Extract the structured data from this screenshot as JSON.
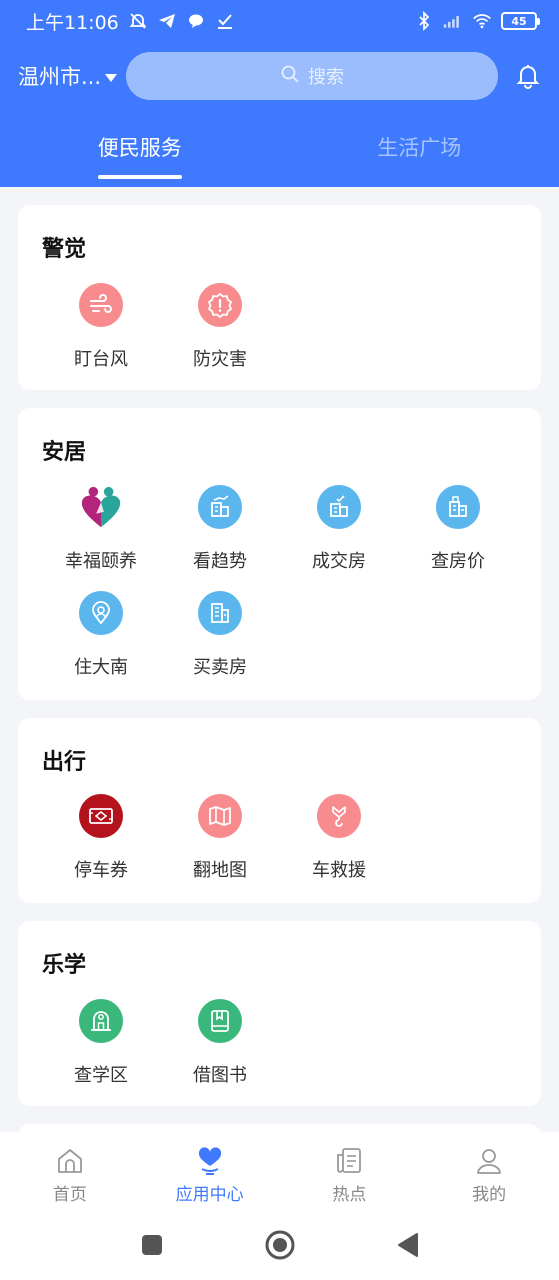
{
  "status_bar": {
    "time": "上午11:06",
    "battery": "45"
  },
  "header": {
    "city": "温州市...",
    "search_placeholder": "搜索"
  },
  "tabs": [
    {
      "label": "便民服务",
      "active": true
    },
    {
      "label": "生活广场",
      "active": false
    }
  ],
  "sections": [
    {
      "title": "警觉",
      "items": [
        {
          "label": "盯台风",
          "icon": "wind-icon",
          "color": "#f78b8d"
        },
        {
          "label": "防灾害",
          "icon": "alert-icon",
          "color": "#f78b8d"
        }
      ]
    },
    {
      "title": "安居",
      "items": [
        {
          "label": "幸福颐养",
          "icon": "heart-people-icon",
          "color": "#2aa59a"
        },
        {
          "label": "看趋势",
          "icon": "building-trend-icon",
          "color": "#5ab6ec"
        },
        {
          "label": "成交房",
          "icon": "building-check-icon",
          "color": "#5ab6ec"
        },
        {
          "label": "查房价",
          "icon": "building-price-icon",
          "color": "#5ab6ec"
        },
        {
          "label": "住大南",
          "icon": "location-pin-icon",
          "color": "#5ab6ec"
        },
        {
          "label": "买卖房",
          "icon": "building-icon",
          "color": "#5ab6ec"
        }
      ]
    },
    {
      "title": "出行",
      "items": [
        {
          "label": "停车券",
          "icon": "parking-ticket-icon",
          "color": "#b4121c"
        },
        {
          "label": "翻地图",
          "icon": "map-icon",
          "color": "#f78b8d"
        },
        {
          "label": "车救援",
          "icon": "tow-hook-icon",
          "color": "#f78b8d"
        }
      ]
    },
    {
      "title": "乐学",
      "items": [
        {
          "label": "查学区",
          "icon": "school-icon",
          "color": "#3ab77b"
        },
        {
          "label": "借图书",
          "icon": "book-icon",
          "color": "#3ab77b"
        }
      ]
    }
  ],
  "bottom_nav": [
    {
      "label": "首页",
      "icon": "home-icon",
      "active": false
    },
    {
      "label": "应用中心",
      "icon": "heart-hand-icon",
      "active": true
    },
    {
      "label": "热点",
      "icon": "news-icon",
      "active": false
    },
    {
      "label": "我的",
      "icon": "user-icon",
      "active": false
    }
  ],
  "colors": {
    "brand": "#3f7afe",
    "search_bg": "#9bbcfd",
    "page_bg": "#f3f5f8"
  }
}
